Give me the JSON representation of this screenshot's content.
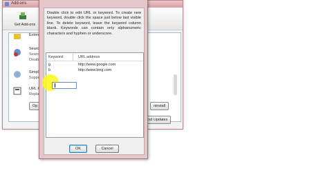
{
  "background_window": {
    "title": "Add-ons",
    "get_addons_label": "Get Add-ons",
    "rows": [
      {
        "t1": "Extens",
        "t2": "",
        "t3": ""
      },
      {
        "t1": "Search",
        "t2": "Search",
        "t3": "Disable"
      },
      {
        "t1": "Simple",
        "t2": "Suppo",
        "t3": ""
      },
      {
        "t1": "URL Ke",
        "t2": "Replac",
        "t3": ""
      }
    ],
    "options_button": "Op",
    "uninstall_button": "ninstall",
    "find_updates_button": "ind Updates"
  },
  "dialog": {
    "title": "",
    "instructions": "Double click to edit URL or keyword. To create new keyword, double click the space just below last visible line. To delete keyword, leave the keyword column blank. Keywords can contain only alphanumeric characters and hyphen or underscore.",
    "columns": [
      "Keyword",
      "URL address"
    ],
    "rows": [
      {
        "keyword": "g",
        "url": "http://www.google.com"
      },
      {
        "keyword": "b",
        "url": "http://www.bing.com"
      }
    ],
    "ok_label": "OK",
    "cancel_label": "Cancel"
  },
  "colors": {
    "dialog_frame": "#e4c7ca",
    "highlight": "#fff814",
    "focus_border": "#6b87c9"
  }
}
